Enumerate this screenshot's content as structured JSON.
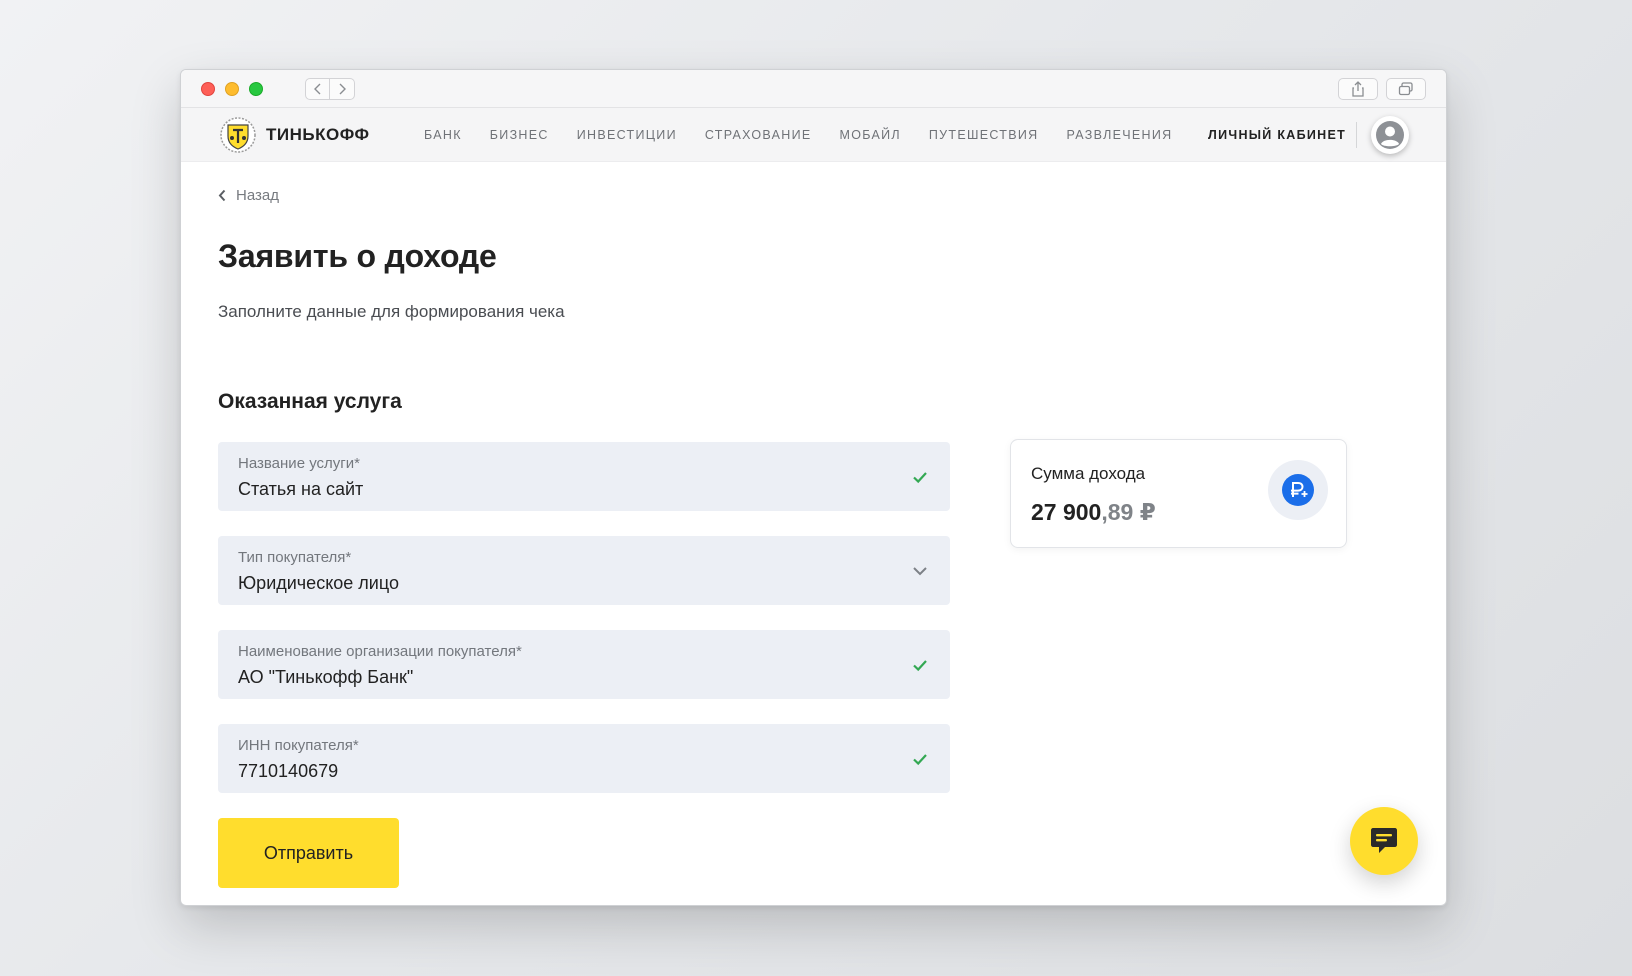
{
  "brand": {
    "name": "ТИНЬКОФФ"
  },
  "nav": {
    "items": [
      "БАНК",
      "БИЗНЕС",
      "ИНВЕСТИЦИИ",
      "СТРАХОВАНИЕ",
      "МОБАЙЛ",
      "ПУТЕШЕСТВИЯ",
      "РАЗВЛЕЧЕНИЯ"
    ],
    "cabinet": "ЛИЧНЫЙ КАБИНЕТ"
  },
  "back": {
    "label": "Назад"
  },
  "page": {
    "title": "Заявить о доходе",
    "subtitle": "Заполните данные для формирования чека"
  },
  "section": {
    "title": "Оказанная услуга"
  },
  "fields": [
    {
      "label": "Название услуги*",
      "value": "Статья на сайт",
      "icon": "check-icon"
    },
    {
      "label": "Тип покупателя*",
      "value": "Юридическое лицо",
      "icon": "chevron-down-icon"
    },
    {
      "label": "Наименование организации покупателя*",
      "value": "АО \"Тинькофф Банк\"",
      "icon": "check-icon"
    },
    {
      "label": "ИНН покупателя*",
      "value": "7710140679",
      "icon": "check-icon"
    }
  ],
  "submit": {
    "label": "Отправить"
  },
  "income": {
    "label": "Сумма дохода",
    "amount_main": "27 900",
    "amount_cents": ",89 ₽"
  },
  "colors": {
    "accent_yellow": "#ffdd2d",
    "field_bg": "#eceff5",
    "check_green": "#33a853",
    "ruble_blue": "#1b6ee9"
  }
}
